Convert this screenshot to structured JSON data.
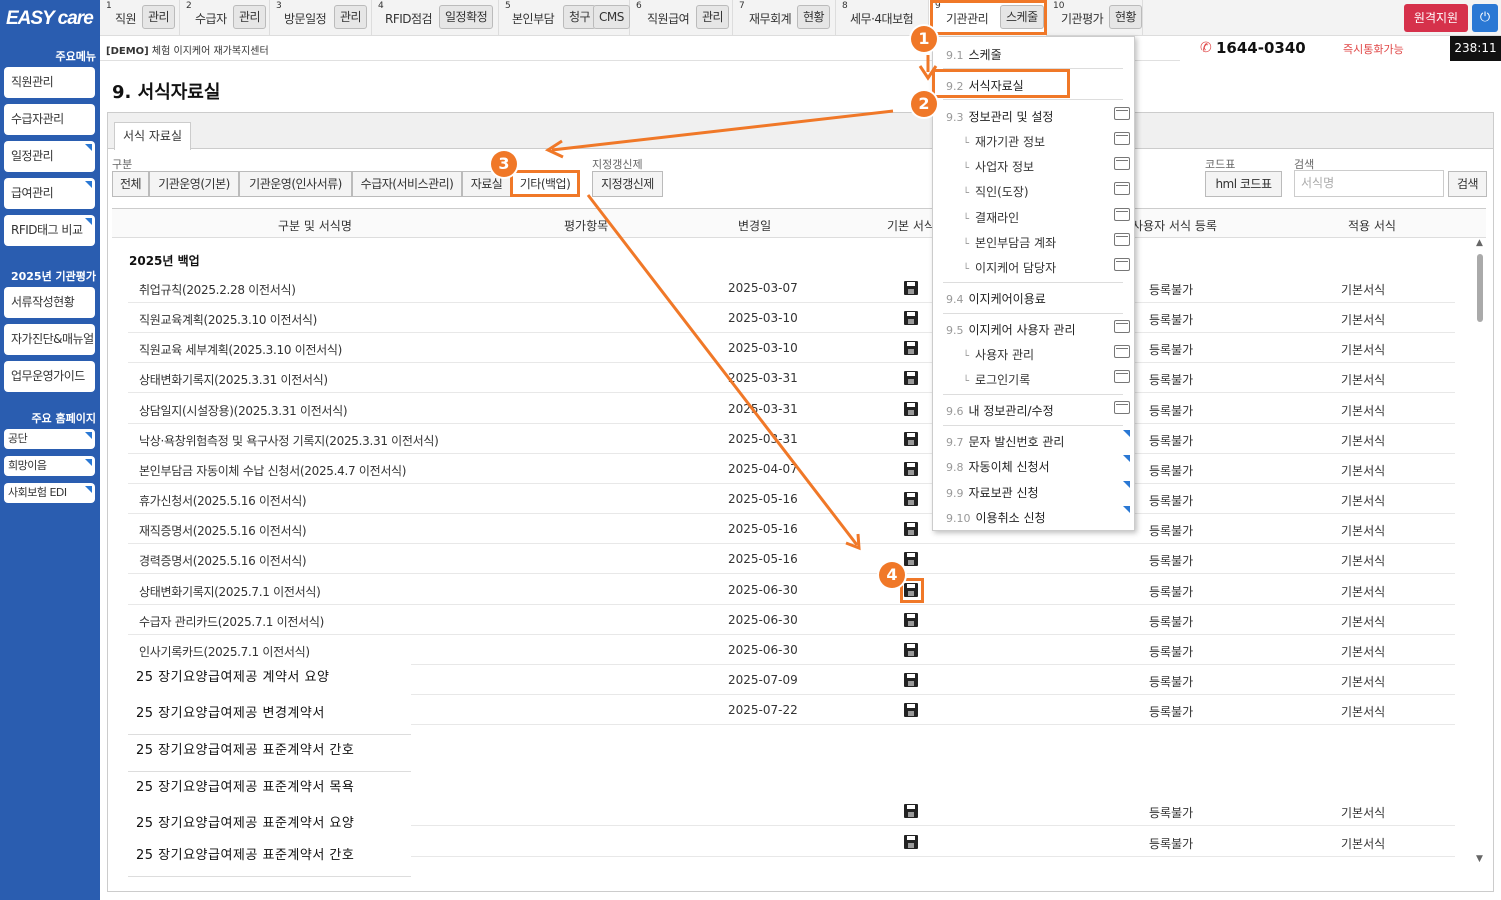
{
  "logo": "EASY care",
  "sidebar": {
    "main_title": "주요메뉴",
    "main_items": [
      "직원관리",
      "수급자관리",
      "일정관리",
      "급여관리",
      "RFID태그 비교"
    ],
    "eval_title": "2025년 기관평가",
    "eval_items": [
      "서류작성현황",
      "자가진단&매뉴얼",
      "업무운영가이드"
    ],
    "home_title": "주요 홈페이지",
    "home_items": [
      "공단",
      "희망이음",
      "사회보험 EDI"
    ]
  },
  "topmenu": [
    {
      "num": "1",
      "label": "직원",
      "btn": "관리"
    },
    {
      "num": "2",
      "label": "수급자",
      "btn": "관리"
    },
    {
      "num": "3",
      "label": "방문일정",
      "btn": "관리"
    },
    {
      "num": "4",
      "label": "RFID점검",
      "btn": "일정확정"
    },
    {
      "num": "5",
      "label": "본인부담",
      "btn": "청구",
      "btn2": "CMS"
    },
    {
      "num": "6",
      "label": "직원급여",
      "btn": "관리"
    },
    {
      "num": "7",
      "label": "재무회계",
      "btn": "현황"
    },
    {
      "num": "8",
      "label": "세무·4대보험"
    },
    {
      "num": "9",
      "label": "기관관리",
      "btn": "스케줄"
    },
    {
      "num": "10",
      "label": "기관평가",
      "btn": "현황"
    }
  ],
  "remote_support": "원격지원",
  "power_icon": "power-icon",
  "demo_tag": "[DEMO]",
  "center_name": "체험 이지케어 재가복지센터",
  "phone": "1644-0340",
  "phone_available": "즉시통화가능",
  "clock": "238:11",
  "page_title": "9. 서식자료실",
  "tab_label": "서식 자료실",
  "filters": {
    "category_label": "구분",
    "buttons": [
      "전체",
      "기관운영(기본)",
      "기관운영(인사서류)",
      "수급자(서비스관리)",
      "자료실",
      "기타(백업)"
    ],
    "designated_label": "지정갱신제",
    "designated_btn": "지정갱신제",
    "code_label": "코드표",
    "code_btn": "hml 코드표",
    "search_label": "검색",
    "search_placeholder": "서식명",
    "search_btn": "검색"
  },
  "table": {
    "headers": [
      "구분 및 서식명",
      "평가항목",
      "변경일",
      "기본 서식",
      "사용자 서식 등록",
      "적용 서식"
    ],
    "group_title": "2025년 백업",
    "rows": [
      {
        "name": "취업규칙(2025.2.28 이전서식)",
        "date": "2025-03-07",
        "reg": "등록불가",
        "apply": "기본서식"
      },
      {
        "name": "직원교육계획(2025.3.10 이전서식)",
        "date": "2025-03-10",
        "reg": "등록불가",
        "apply": "기본서식"
      },
      {
        "name": "직원교육 세부계획(2025.3.10 이전서식)",
        "date": "2025-03-10",
        "reg": "등록불가",
        "apply": "기본서식"
      },
      {
        "name": "상태변화기록지(2025.3.31 이전서식)",
        "date": "2025-03-31",
        "reg": "등록불가",
        "apply": "기본서식"
      },
      {
        "name": "상담일지(시설장용)(2025.3.31 이전서식)",
        "date": "2025-03-31",
        "reg": "등록불가",
        "apply": "기본서식"
      },
      {
        "name": "낙상·욕창위험측정 및 욕구사정 기록지(2025.3.31 이전서식)",
        "date": "2025-03-31",
        "reg": "등록불가",
        "apply": "기본서식"
      },
      {
        "name": "본인부담금 자동이체 수납 신청서(2025.4.7 이전서식)",
        "date": "2025-04-07",
        "reg": "등록불가",
        "apply": "기본서식"
      },
      {
        "name": "휴가신청서(2025.5.16 이전서식)",
        "date": "2025-05-16",
        "reg": "등록불가",
        "apply": "기본서식"
      },
      {
        "name": "재직증명서(2025.5.16 이전서식)",
        "date": "2025-05-16",
        "reg": "등록불가",
        "apply": "기본서식"
      },
      {
        "name": "경력증명서(2025.5.16 이전서식)",
        "date": "2025-05-16",
        "reg": "등록불가",
        "apply": "기본서식"
      },
      {
        "name": "상태변화기록지(2025.7.1 이전서식)",
        "date": "2025-06-30",
        "reg": "등록불가",
        "apply": "기본서식"
      },
      {
        "name": "수급자 관리카드(2025.7.1 이전서식)",
        "date": "2025-06-30",
        "reg": "등록불가",
        "apply": "기본서식"
      },
      {
        "name": "인사기록카드(2025.7.1 이전서식)",
        "date": "2025-06-30",
        "reg": "등록불가",
        "apply": "기본서식"
      },
      {
        "name": "",
        "date": "2025-07-09",
        "reg": "등록불가",
        "apply": "기본서식"
      },
      {
        "name": "",
        "date": "2025-07-22",
        "reg": "등록불가",
        "apply": "기본서식"
      }
    ],
    "tail_rows": [
      {
        "reg": "등록불가",
        "apply": "기본서식"
      },
      {
        "reg": "등록불가",
        "apply": "기본서식"
      }
    ],
    "overlay_items": [
      "25 장기요양급여제공 계약서 요양",
      "25 장기요양급여제공 변경계약서",
      "25 장기요양급여제공 표준계약서 간호",
      "25 장기요양급여제공 표준계약서 목욕",
      "25 장기요양급여제공 표준계약서 요양",
      "25 장기요양급여제공 표준계약서 간호"
    ]
  },
  "dropdown": [
    {
      "num": "9.1",
      "label": "스케줄"
    },
    {
      "num": "9.2",
      "label": "서식자료실"
    },
    {
      "num": "9.3",
      "label": "정보관리 및 설정",
      "subs": [
        "재가기관 정보",
        "사업자 정보",
        "직인(도장)",
        "결재라인",
        "본인부담금 계좌",
        "이지케어 담당자"
      ]
    },
    {
      "num": "9.4",
      "label": "이지케어이용료"
    },
    {
      "num": "9.5",
      "label": "이지케어 사용자 관리",
      "subs": [
        "사용자 관리",
        "로그인기록"
      ]
    },
    {
      "num": "9.6",
      "label": "내 정보관리/수정"
    },
    {
      "num": "9.7",
      "label": "문자 발신번호 관리"
    },
    {
      "num": "9.8",
      "label": "자동이체 신청서"
    },
    {
      "num": "9.9",
      "label": "자료보관 신청"
    },
    {
      "num": "9.10",
      "label": "이용취소 신청"
    }
  ],
  "annotations": [
    "1",
    "2",
    "3",
    "4"
  ],
  "accent_color": "#f07828",
  "sidebar_color": "#2a5db0"
}
